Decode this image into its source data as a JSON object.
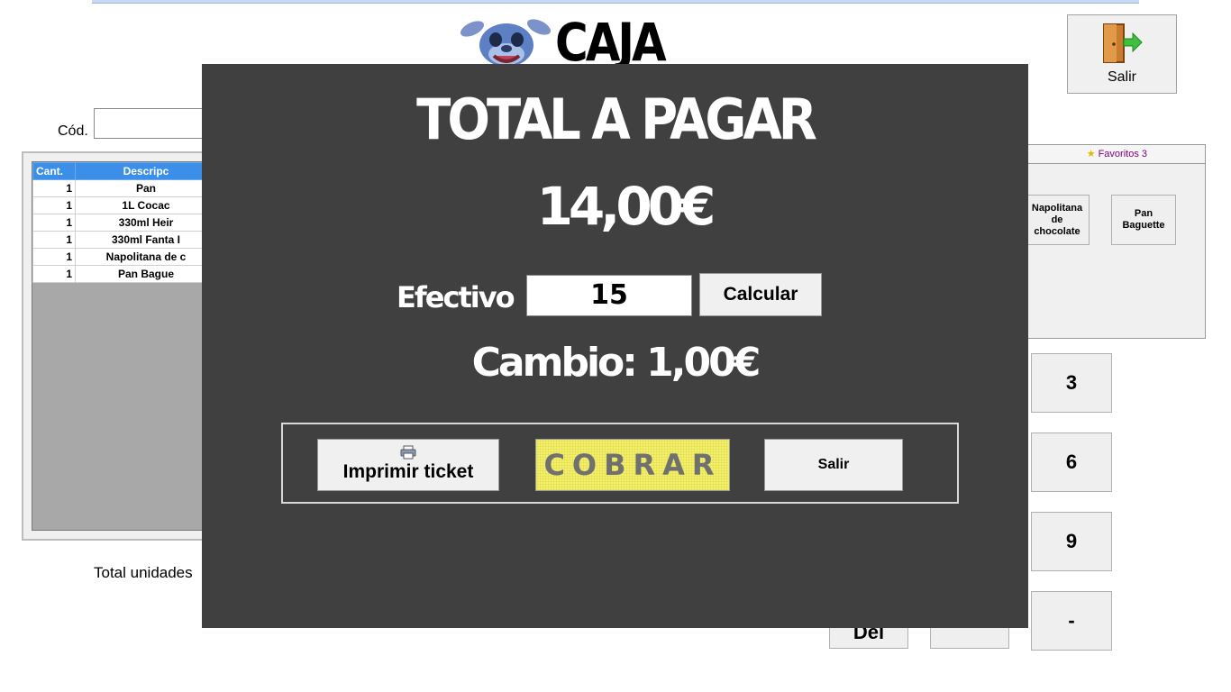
{
  "header": {
    "title": "CAJA",
    "exit_label": "Salir"
  },
  "code_field": {
    "label": "Cód.",
    "value": ""
  },
  "items_table": {
    "columns": [
      "Cant.",
      "Descripción"
    ],
    "column_visible_text": [
      "Cant.",
      "Descripc"
    ],
    "rows": [
      {
        "qty": "1",
        "desc": "Pan"
      },
      {
        "qty": "1",
        "desc": "1L Cocac"
      },
      {
        "qty": "1",
        "desc": "330ml Heir"
      },
      {
        "qty": "1",
        "desc": "330ml Fanta I"
      },
      {
        "qty": "1",
        "desc": "Napolitana de c"
      },
      {
        "qty": "1",
        "desc": "Pan Bague"
      }
    ]
  },
  "footer": {
    "total_units_label": "Total unidades"
  },
  "favorites": {
    "tab_label": "Favoritos 3",
    "items": [
      {
        "label_lines": [
          "Napolitana",
          "de",
          "chocolate"
        ]
      },
      {
        "label_lines": [
          "Pan",
          "Baguette"
        ]
      }
    ]
  },
  "keypad": {
    "keys": [
      "3",
      "6",
      "9",
      "-",
      "Del",
      ""
    ]
  },
  "payment_modal": {
    "heading": "TOTAL A PAGAR",
    "total": "14,00€",
    "cash_label": "Efectivo",
    "cash_value": "15",
    "calculate_label": "Calcular",
    "change_text": "Cambio: 1,00€",
    "print_label": "Imprimir ticket",
    "charge_label": "COBRAR",
    "exit_label": "Salir"
  },
  "colors": {
    "modal_bg": "#404040",
    "table_header": "#3b8fe8",
    "charge_button": "#f3ef6a",
    "favorites_tab_text": "#800080"
  },
  "icons": [
    "stitch-logo",
    "exit-door-icon",
    "printer-icon",
    "star-icon"
  ]
}
